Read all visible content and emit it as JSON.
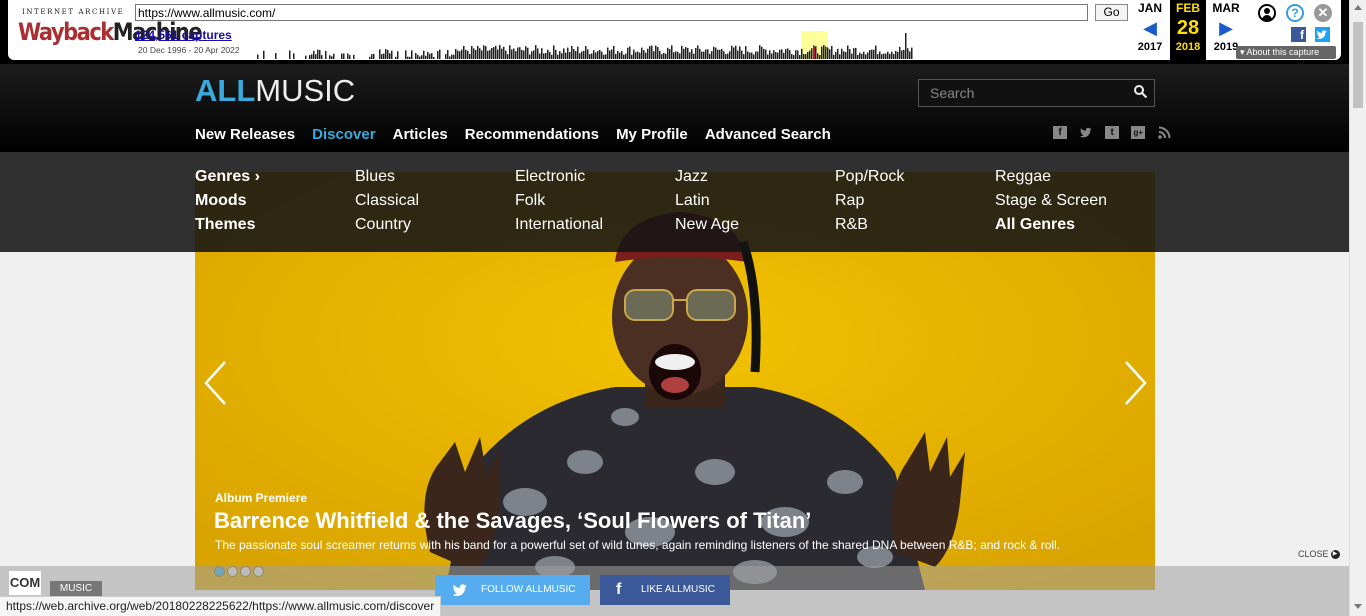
{
  "wayback": {
    "logo_top": "INTERNET ARCHIVE",
    "logo_main_1": "Wayback",
    "logo_main_2": "Machine",
    "url_value": "https://www.allmusic.com/",
    "go_label": "Go",
    "captures": "124,561 captures",
    "date_range": "20 Dec 1996 - 20 Apr 2022",
    "prev": {
      "month": "JAN",
      "year": "2017"
    },
    "current": {
      "month": "FEB",
      "day": "28",
      "year": "2018"
    },
    "next": {
      "month": "MAR",
      "year": "2019"
    },
    "about": "About this capture",
    "fb_letter": "f"
  },
  "header": {
    "logo_all": "ALL",
    "logo_music": "MUSIC",
    "search_placeholder": "Search",
    "nav": [
      "New Releases",
      "Discover",
      "Articles",
      "Recommendations",
      "My Profile",
      "Advanced Search"
    ],
    "nav_active": "Discover",
    "social": [
      "f",
      "t",
      "t",
      "g+",
      "rss"
    ]
  },
  "dropdown": {
    "col1": [
      "Genres ›",
      "Moods",
      "Themes"
    ],
    "col2": [
      "Blues",
      "Classical",
      "Country"
    ],
    "col3": [
      "Electronic",
      "Folk",
      "International"
    ],
    "col4": [
      "Jazz",
      "Latin",
      "New Age"
    ],
    "col5": [
      "Pop/Rock",
      "Rap",
      "R&B"
    ],
    "col6": [
      "Reggae",
      "Stage & Screen",
      "All Genres"
    ]
  },
  "hero": {
    "kicker": "Album Premiere",
    "title": "Barrence Whitfield & the Savages, ‘Soul Flowers of Titan’",
    "description": "The passionate soul screamer returns with his band for a powerful set of wild tunes, again reminding listeners of the shared DNA between R&B; and rock & roll.",
    "dots": 4,
    "active_dot": 0
  },
  "footer": {
    "com_logo": "COM",
    "music_tag": "MUSIC",
    "follow": "FOLLOW ALLMUSIC",
    "like": "LIKE ALLMUSIC",
    "close": "CLOSE"
  },
  "status_url": "https://web.archive.org/web/20180228225622/https://www.allmusic.com/discover",
  "colors": {
    "accent": "#39aadb",
    "hero_bg": "#e2b000",
    "twitter": "#55acee",
    "facebook": "#3b5998"
  }
}
